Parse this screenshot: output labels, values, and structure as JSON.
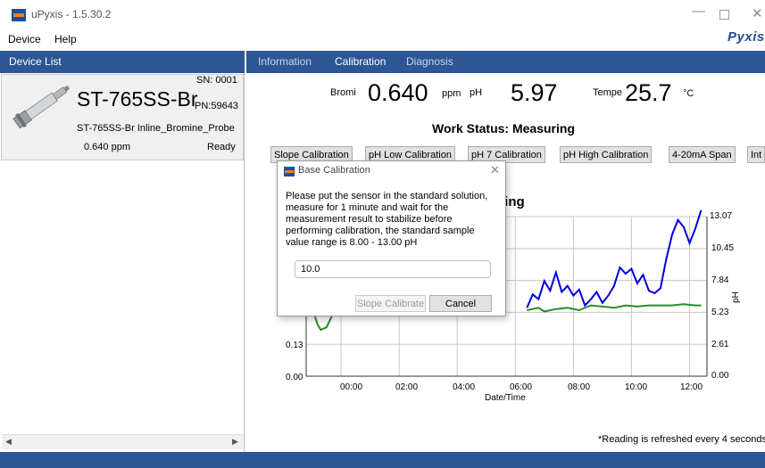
{
  "window": {
    "title": "uPyxis - 1.5.30.2",
    "brand": "Pyxis"
  },
  "menu": {
    "device": "Device",
    "help": "Help"
  },
  "device_list": {
    "header": "Device List",
    "devices": [
      {
        "name": "ST-765SS-Br",
        "sn": "SN: 0001",
        "pn": "PN:59643",
        "full_name": "ST-765SS-Br Inline_Bromine_Probe",
        "reading": "0.640  ppm",
        "status": "Ready"
      }
    ]
  },
  "tabs": [
    {
      "label": "Information"
    },
    {
      "label": "Calibration"
    },
    {
      "label": "Diagnosis"
    }
  ],
  "active_tab": "Calibration",
  "readings": {
    "bromine_label": "Bromi",
    "bromine_value": "0.640",
    "bromine_unit": "ppm",
    "ph_label": "pH",
    "ph_value": "5.97",
    "temp_label": "Tempe",
    "temp_value": "25.7",
    "temp_unit": "°C"
  },
  "work_status": "Work Status:  Measuring",
  "calibration_buttons": [
    "Slope Calibration",
    "pH Low Calibration",
    "pH 7 Calibration",
    "pH High Calibration",
    "4-20mA Span",
    "Int"
  ],
  "chart_title_fragment": "ding",
  "chart_data": {
    "type": "line",
    "title": "",
    "xlabel": "Date/Time",
    "ylabel_right": "pH",
    "x_ticks": [
      "00:00",
      "02:00",
      "04:00",
      "06:00",
      "08:00",
      "10:00",
      "12:00"
    ],
    "y_left_ticks": [
      "0.00",
      "0.13"
    ],
    "y_right_ticks": [
      "0.00",
      "2.61",
      "5.23",
      "7.84",
      "10.45",
      "13.07"
    ],
    "xlim": [
      -1.2,
      12.6
    ],
    "ylim_right": [
      0,
      13.07
    ],
    "series": [
      {
        "color": "#0000dd",
        "axis": "right",
        "x": [
          6.4,
          6.6,
          6.8,
          7.0,
          7.2,
          7.4,
          7.6,
          7.8,
          8.0,
          8.2,
          8.4,
          8.6,
          8.8,
          9.0,
          9.2,
          9.4,
          9.6,
          9.8,
          10.0,
          10.2,
          10.4,
          10.6,
          10.8,
          11.0,
          11.2,
          11.4,
          11.6,
          11.8,
          12.0,
          12.2,
          12.4
        ],
        "y": [
          5.6,
          6.7,
          6.3,
          7.8,
          7.0,
          8.5,
          6.9,
          7.4,
          6.6,
          7.1,
          5.8,
          6.3,
          6.9,
          6.0,
          6.6,
          7.4,
          8.9,
          8.4,
          8.8,
          7.6,
          8.3,
          7.0,
          6.8,
          7.2,
          9.6,
          11.6,
          12.8,
          12.2,
          10.9,
          12.1,
          13.6
        ]
      },
      {
        "color": "#2a8a2a",
        "axis": "right",
        "x": [
          -1.0,
          -0.9,
          -0.8,
          -0.7,
          -0.5,
          -0.3,
          6.4,
          6.8,
          7.0,
          7.4,
          7.8,
          8.2,
          8.6,
          9.0,
          9.4,
          9.8,
          10.2,
          10.6,
          11.0,
          11.4,
          11.8,
          12.2,
          12.4
        ],
        "y": [
          5.3,
          4.9,
          4.2,
          3.8,
          4.0,
          5.0,
          5.4,
          5.6,
          5.3,
          5.5,
          5.6,
          5.4,
          5.8,
          5.7,
          5.6,
          5.8,
          5.7,
          5.8,
          5.8,
          5.8,
          5.9,
          5.8,
          5.8
        ]
      }
    ]
  },
  "footnote": "*Reading is refreshed every 4 seconds",
  "dialog": {
    "title": "Base Calibration",
    "message": "Please put the sensor in the standard solution, measure for 1 minute and wait for the measurement result to stabilize before performing calibration, the standard sample value range is 8.00 - 13.00 pH",
    "input_value": "10.0",
    "slope_button": "Slope Calibrate",
    "cancel_button": "Cancel"
  },
  "colors": {
    "accent": "#2d5694",
    "series_1": "#0000dd",
    "series_2": "#2a8a2a"
  }
}
